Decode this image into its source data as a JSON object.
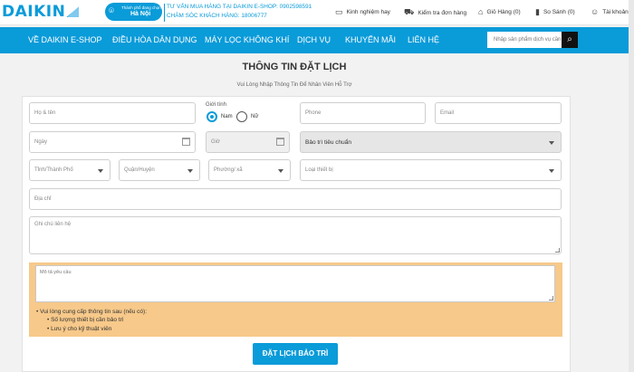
{
  "brand": {
    "logo_text": "DAIKIN"
  },
  "location": {
    "hint": "Thành phố đang chọn",
    "city": "Hà Nội"
  },
  "hotline": {
    "line1": "TƯ VẤN MUA HÀNG TẠI DAIKIN E-SHOP: 0902598591",
    "line2": "CHĂM SÓC KHÁCH HÀNG: 18006777"
  },
  "top_nav": [
    {
      "label": "Kinh nghiệm hay",
      "icon": "monitor-icon"
    },
    {
      "label": "Kiểm tra đơn hàng",
      "icon": "delivery-icon"
    },
    {
      "label": "Giỏ Hàng (0)",
      "icon": "cart-icon"
    },
    {
      "label": "So Sánh (0)",
      "icon": "compare-icon"
    },
    {
      "label": "Tài khoản",
      "icon": "user-icon"
    }
  ],
  "main_nav": [
    "VỀ DAIKIN E-SHOP",
    "ĐIỀU HÒA DÂN DỤNG",
    "MÁY LỌC KHÔNG KHÍ",
    "DỊCH VỤ",
    "KHUYẾN MÃI",
    "LIÊN HỆ"
  ],
  "search": {
    "placeholder": "Nhập sản phẩm dịch vụ cần"
  },
  "page": {
    "title": "THÔNG TIN ĐẶT LỊCH",
    "subtitle": "Vui Lòng Nhập Thông Tin Để Nhân Viên Hỗ Trợ"
  },
  "form": {
    "name_placeholder": "Họ & tên",
    "gender_label": "Giới tính",
    "gender_male": "Nam",
    "gender_female": "Nữ",
    "gender_selected": "Nam",
    "phone_placeholder": "Phone",
    "email_placeholder": "Email",
    "date_placeholder": "Ngày",
    "time_placeholder": "Giờ",
    "service_value": "Bảo trì tiêu chuẩn",
    "province_placeholder": "Tỉnh/Thành Phố",
    "district_placeholder": "Quận/Huyện",
    "ward_placeholder": "Phường/ xã",
    "device_placeholder": "Loại thiết bị",
    "address_placeholder": "Địa chỉ",
    "note_placeholder": "Ghi chú liên hệ",
    "request_placeholder": "Mô tả yêu cầu",
    "info_intro": "Vui lòng cung cấp thông tin sau (nếu có):",
    "info_items": [
      "Số lượng thiết bị cần bảo trì",
      "Lưu ý cho kỹ thuật viên"
    ],
    "submit_label": "ĐẶT LỊCH BẢO TRÌ"
  },
  "colors": {
    "brand_blue": "#0a9bd9",
    "highlight": "#f7c98a",
    "button_dark": "#111111"
  }
}
